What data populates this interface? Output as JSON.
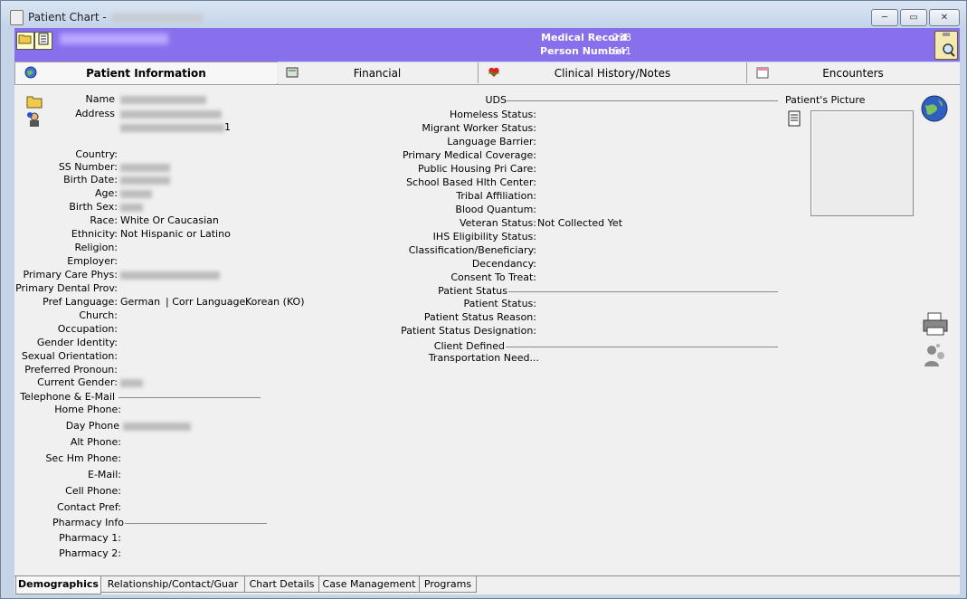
{
  "window": {
    "title": "Patient Chart -",
    "btn_min": "─",
    "btn_max": "▭",
    "btn_close": "✕"
  },
  "header": {
    "medical_record_label": "Medical Record",
    "medical_record_value": "238",
    "person_number_label": "Person Number",
    "person_number_value": "641"
  },
  "tabs": [
    {
      "label": "Patient Information",
      "icon": "globe-icon"
    },
    {
      "label": "Financial",
      "icon": "calculator-icon"
    },
    {
      "label": "Clinical History/Notes",
      "icon": "heart-icon"
    },
    {
      "label": "Encounters",
      "icon": "calendar-icon"
    }
  ],
  "left": {
    "name_label": "Name",
    "address_label": "Address",
    "address_suffix": "1",
    "country_label": "Country:",
    "ssn_label": "SS Number:",
    "birth_date_label": "Birth Date:",
    "age_label": "Age:",
    "birth_sex_label": "Birth Sex:",
    "race_label": "Race:",
    "race_value": "White Or Caucasian",
    "ethnicity_label": "Ethnicity:",
    "ethnicity_value": "Not Hispanic or Latino",
    "religion_label": "Religion:",
    "employer_label": "Employer:",
    "pcp_label": "Primary Care Phys:",
    "dental_label": "Primary Dental Prov:",
    "pref_language_label": "Pref Language:",
    "pref_language_value": "German",
    "corr_language_label": "| Corr Language:",
    "corr_language_value": "Korean (KO)",
    "church_label": "Church:",
    "occupation_label": "Occupation:",
    "gender_identity_label": "Gender Identity:",
    "sexual_orientation_label": "Sexual Orientation:",
    "pronoun_label": "Preferred Pronoun:",
    "current_gender_label": "Current Gender:",
    "tel_section": "Telephone & E-Mail",
    "home_phone_label": "Home Phone:",
    "day_phone_label": "Day Phone",
    "alt_phone_label": "Alt Phone:",
    "sec_phone_label": "Sec Hm Phone:",
    "email_label": "E-Mail:",
    "cell_label": "Cell Phone:",
    "contact_pref_label": "Contact Pref:",
    "pharmacy_section": "Pharmacy Info",
    "pharmacy1_label": "Pharmacy 1:",
    "pharmacy2_label": "Pharmacy 2:"
  },
  "middle": {
    "uds_section": "UDS",
    "homeless_label": "Homeless Status:",
    "migrant_label": "Migrant Worker Status:",
    "language_barrier_label": "Language Barrier:",
    "primary_medical_label": "Primary Medical Coverage:",
    "public_housing_label": "Public Housing Pri Care:",
    "school_label": "School Based Hlth Center:",
    "tribal_label": "Tribal Affiliation:",
    "blood_label": "Blood Quantum:",
    "veteran_label": "Veteran Status:",
    "veteran_value": "Not Collected Yet",
    "ihs_label": "IHS Eligibility Status:",
    "classification_label": "Classification/Beneficiary:",
    "decendancy_label": "Decendancy:",
    "consent_label": "Consent To Treat:",
    "patient_status_section": "Patient Status",
    "patient_status_label": "Patient Status:",
    "patient_status_reason_label": "Patient Status Reason:",
    "patient_status_designation_label": "Patient Status Designation:",
    "client_defined_section": "Client Defined",
    "transportation_label": "Transportation Need..."
  },
  "right": {
    "picture_label": "Patient's Picture"
  },
  "bottom_tabs": [
    "Demographics",
    "Relationship/Contact/Guar",
    "Chart Details",
    "Case Management",
    "Programs"
  ]
}
